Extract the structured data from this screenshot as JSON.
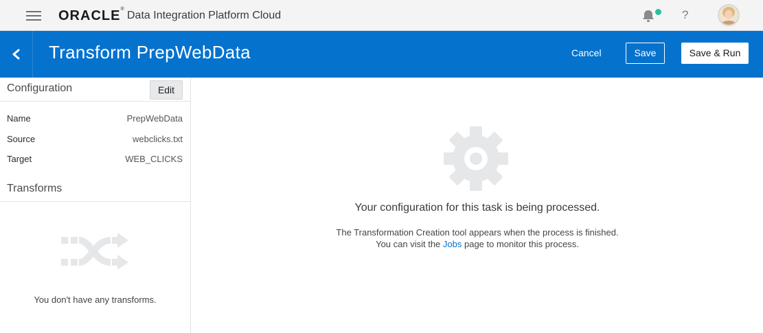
{
  "header": {
    "logo": "ORACLE",
    "logo_mark": "®",
    "app_title": "Data Integration Platform Cloud",
    "icons": [
      "menu-icon",
      "bell-icon",
      "help-icon",
      "avatar"
    ],
    "help_label": "?",
    "notification_dot_color": "#2bbfa0"
  },
  "band": {
    "title": "Transform PrepWebData",
    "cancel_label": "Cancel",
    "save_label": "Save",
    "save_run_label": "Save & Run",
    "color": "#0572ce"
  },
  "configuration": {
    "title": "Configuration",
    "edit_label": "Edit",
    "properties": [
      {
        "key": "Name",
        "value": "PrepWebData"
      },
      {
        "key": "Source",
        "value": "webclicks.txt"
      },
      {
        "key": "Target",
        "value": "WEB_CLICKS"
      }
    ]
  },
  "transforms": {
    "title": "Transforms",
    "empty_text": "You don't have any transforms."
  },
  "main": {
    "processing_text": "Your configuration for this task is being processed.",
    "info_line1": "The Transformation Creation tool appears when the process is finished.",
    "info_line2_prefix": "You can visit the ",
    "info_line2_link": "Jobs",
    "info_line2_suffix": " page to monitor this process."
  }
}
